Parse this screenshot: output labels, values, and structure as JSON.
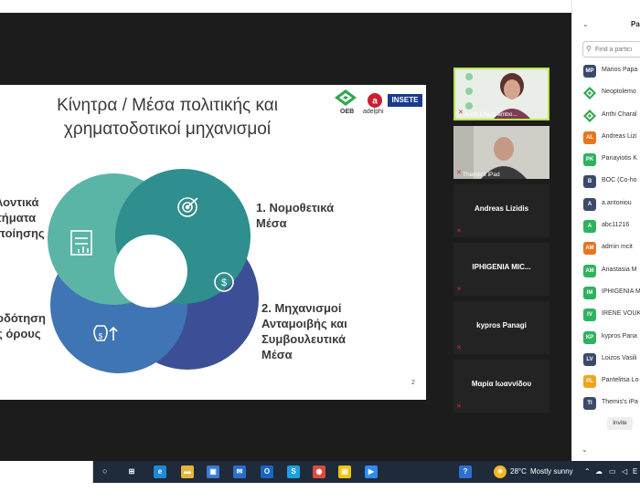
{
  "slide": {
    "title_line1": "Κίνητρα / Μέσα πολιτικής και",
    "title_line2": "χρηματοδοτικοί μηχανισμοί",
    "logos": {
      "oeb": "ΟΕΒ",
      "adelphi": "adelphi",
      "insete": "INSETE"
    },
    "segments": [
      {
        "line1": "1. Νομοθετικά",
        "line2": "Μέσα",
        "line3": ""
      },
      {
        "line1": "2. Μηχανισμοί",
        "line2": "Ανταμοιβής και",
        "line3": "Συμβουλευτικά",
        "line4": "Μέσα"
      },
      {
        "line1": "οδότηση",
        "line2": "ς όρους"
      },
      {
        "line1": "λοντικά",
        "line2": "τήματα",
        "line3": "ποίησης"
      }
    ],
    "page_number": "2",
    "colors": {
      "teal": "#5bb5a6",
      "teal_dark": "#2f8e8e",
      "blue": "#3f74b5",
      "navy": "#3c4f96"
    }
  },
  "video_tiles": [
    {
      "name": "Anthi Chara ambo...",
      "type": "video"
    },
    {
      "name": "Themis's iPad",
      "type": "video"
    },
    {
      "name": "Andreas Lizidis",
      "type": "name"
    },
    {
      "name": "IPHIGENIA MIC...",
      "type": "name"
    },
    {
      "name": "kypros Panagi",
      "type": "name"
    },
    {
      "name": "Μαρία Ιωαννίδου",
      "type": "name"
    }
  ],
  "panel": {
    "title": "Par",
    "search_placeholder": "Find a partici",
    "invite_label": "Invite",
    "participants": [
      {
        "initials": "MP",
        "name": "Marios Papa",
        "color": "#3b4a6b"
      },
      {
        "initials": "",
        "name": "Neoptolemo",
        "color": "#2fa84f",
        "logo": true
      },
      {
        "initials": "",
        "name": "Anthi Charal",
        "color": "#2fa84f",
        "logo": true
      },
      {
        "initials": "AL",
        "name": "Andreas Lizi",
        "color": "#e8741e"
      },
      {
        "initials": "PK",
        "name": "Panayiotis K",
        "color": "#2fb25f"
      },
      {
        "initials": "B",
        "name": "BOC (Co-ho",
        "color": "#3b4a6b"
      },
      {
        "initials": "A",
        "name": "a.antoniou",
        "color": "#3b4a6b"
      },
      {
        "initials": "A",
        "name": "abc11216",
        "color": "#2fb25f"
      },
      {
        "initials": "AM",
        "name": "admin mcit",
        "color": "#e8741e"
      },
      {
        "initials": "AM",
        "name": "Anastasia M",
        "color": "#2fb25f"
      },
      {
        "initials": "IM",
        "name": "IPHIGENIA M",
        "color": "#2fb25f"
      },
      {
        "initials": "IV",
        "name": "IRENE VOUK",
        "color": "#2fb25f"
      },
      {
        "initials": "KP",
        "name": "kypros Pana",
        "color": "#2fb25f"
      },
      {
        "initials": "LV",
        "name": "Loizos Vasili",
        "color": "#3b4a6b"
      },
      {
        "initials": "PL",
        "name": "Pantelitsa Lo",
        "color": "#f0a41e"
      },
      {
        "initials": "TI",
        "name": "Themis's iPa",
        "color": "#3b4a6b"
      }
    ]
  },
  "taskbar": {
    "weather_temp": "28°C",
    "weather_text": "Mostly sunny",
    "apps": [
      {
        "name": "task-view-icon",
        "glyph": "⊞",
        "color": "#1f2a3a"
      },
      {
        "name": "edge-icon",
        "glyph": "e",
        "color": "#1d8ad1"
      },
      {
        "name": "file-explorer-icon",
        "glyph": "▬",
        "color": "#e8b53a"
      },
      {
        "name": "store-icon",
        "glyph": "▣",
        "color": "#3a7bd5"
      },
      {
        "name": "mail-icon",
        "glyph": "✉",
        "color": "#2a6fc9"
      },
      {
        "name": "outlook-icon",
        "glyph": "O",
        "color": "#1665c0"
      },
      {
        "name": "skype-icon",
        "glyph": "S",
        "color": "#1ea0e0"
      },
      {
        "name": "chrome-icon",
        "glyph": "◉",
        "color": "#dd4b39"
      },
      {
        "name": "sticky-notes-icon",
        "glyph": "▤",
        "color": "#f2c311"
      },
      {
        "name": "zoom-icon",
        "glyph": "▶",
        "color": "#2d8cff"
      },
      {
        "name": "help-icon",
        "glyph": "?",
        "color": "#2d6fd2"
      }
    ]
  }
}
